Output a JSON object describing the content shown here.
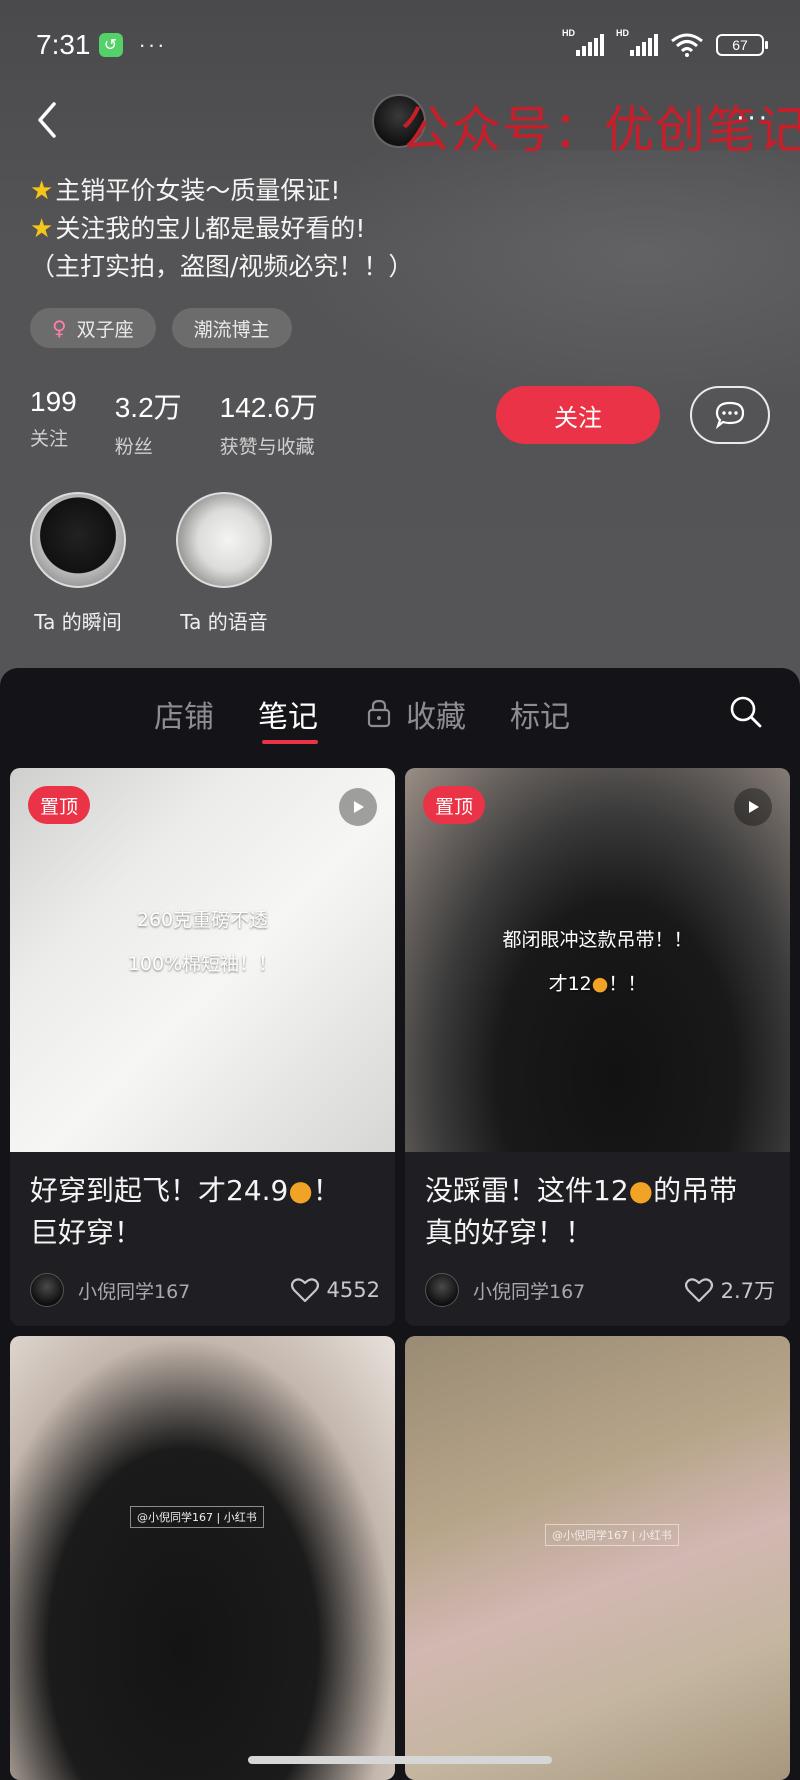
{
  "status": {
    "time": "7:31",
    "more": "···",
    "battery": "67"
  },
  "nav": {
    "watermark": "公众号：优创笔记",
    "more": "···"
  },
  "bio": {
    "lines": [
      "主销平价女装～质量保证!",
      "关注我的宝儿都是最好看的!",
      "（主打实拍，盗图/视频必究！！）"
    ]
  },
  "tags": [
    {
      "label": "双子座",
      "icon": "female-icon"
    },
    {
      "label": "潮流博主"
    }
  ],
  "stats": [
    {
      "num": "199",
      "label": "关注"
    },
    {
      "num": "3.2万",
      "label": "粉丝"
    },
    {
      "num": "142.6万",
      "label": "获赞与收藏"
    }
  ],
  "actions": {
    "follow": "关注"
  },
  "moments": [
    {
      "label": "Ta 的瞬间"
    },
    {
      "label": "Ta 的语音"
    }
  ],
  "tabs": [
    "店铺",
    "笔记",
    "收藏",
    "标记"
  ],
  "active_tab": "笔记",
  "cards": [
    {
      "badge": "置顶",
      "overlay": [
        "260克重磅不透",
        "100%棉短袖！！"
      ],
      "title_a": "好穿到起飞！才24.9",
      "title_b": "！",
      "title_line2": "巨好穿！",
      "author": "小倪同学167",
      "likes": "4552"
    },
    {
      "badge": "置顶",
      "overlay": [
        "都闭眼冲这款吊带！！",
        "才12"
      ],
      "overlay_tail": "！！",
      "title_a": "没踩雷！这件12",
      "title_b": "的吊带",
      "title_line2": "真的好穿！！",
      "author": "小倪同学167",
      "likes": "2.7万"
    },
    {
      "tiny": "@小倪同学167 | 小红书"
    },
    {
      "tiny": "@小倪同学167 | 小红书"
    }
  ]
}
